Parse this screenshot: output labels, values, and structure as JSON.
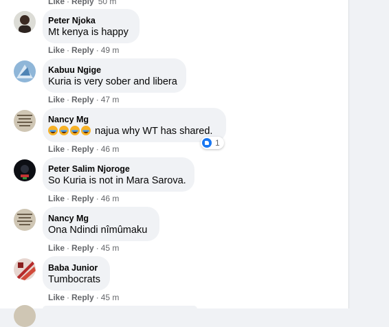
{
  "top_partial": {
    "like": "Like",
    "reply": "Reply",
    "time": "50 m"
  },
  "comments": [
    {
      "author": "Peter Njoka",
      "text": "Mt kenya is happy",
      "like": "Like",
      "reply": "Reply",
      "time": "49 m"
    },
    {
      "author": "Kabuu Ngige",
      "text": "Kuria is very sober and libera",
      "like": "Like",
      "reply": "Reply",
      "time": "47 m"
    },
    {
      "author": "Nancy Mg",
      "text": " najua why WT has shared.",
      "like": "Like",
      "reply": "Reply",
      "time": "46 m",
      "reactions": {
        "icon": "like-icon",
        "count": "1"
      }
    },
    {
      "author": "Peter Salim Njoroge",
      "text": "So Kuria is not in Mara Sarova.",
      "like": "Like",
      "reply": "Reply",
      "time": "46 m"
    },
    {
      "author": "Nancy Mg",
      "text": "Ona Ndindi nîmûmaku",
      "like": "Like",
      "reply": "Reply",
      "time": "45 m"
    },
    {
      "author": "Baba Junior",
      "text": "Tumbocrats",
      "like": "Like",
      "reply": "Reply",
      "time": "45 m"
    }
  ],
  "colors": {
    "accent": "#1877f2",
    "bubble": "#f0f2f5",
    "meta": "#65676b"
  }
}
